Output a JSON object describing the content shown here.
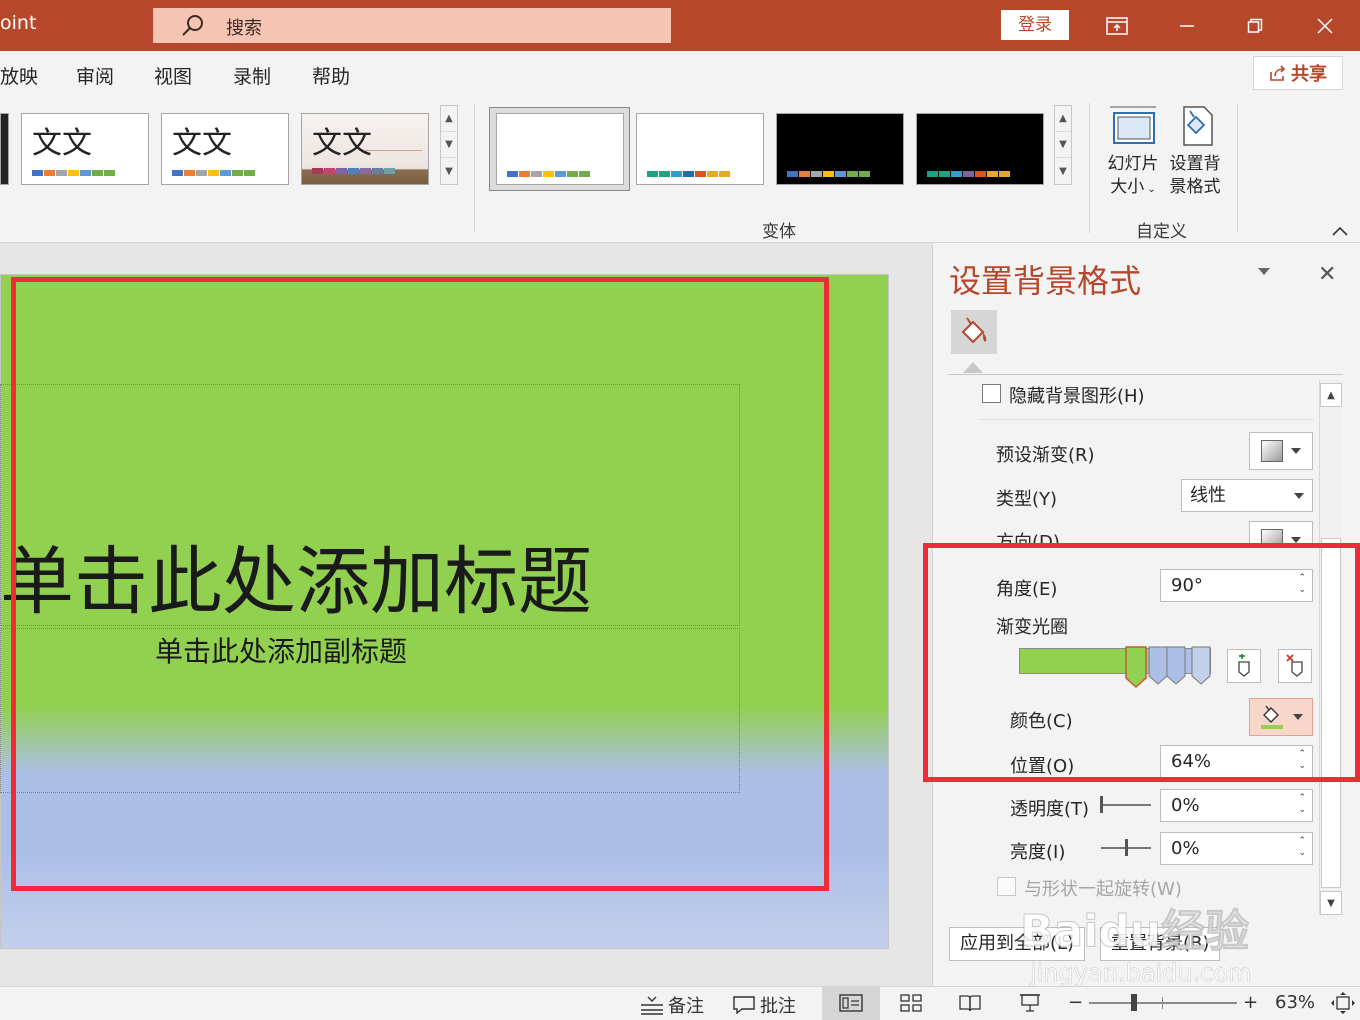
{
  "titlebar": {
    "app_title": "oint",
    "search_placeholder": "搜索",
    "login_label": "登录",
    "colors": {
      "background": "#b7472a",
      "search_bg": "#f6c4b3"
    }
  },
  "menu": {
    "tabs": [
      "放映",
      "审阅",
      "视图",
      "录制",
      "帮助"
    ],
    "share_label": "共享"
  },
  "ribbon": {
    "theme_thumb_text": "文文",
    "variants_group_label": "变体",
    "customize_group_label": "自定义",
    "slide_size_label_1": "幻灯片",
    "slide_size_label_2": "大小",
    "bg_format_label_1": "设置背",
    "bg_format_label_2": "景格式"
  },
  "slide": {
    "title_placeholder": "单击此处添加标题",
    "subtitle_placeholder": "单击此处添加副标题",
    "colors": {
      "top": "#92d050",
      "bottom": "#acbfe6"
    }
  },
  "pane": {
    "title": "设置背景格式",
    "hide_bg_graphics": "隐藏背景图形(H)",
    "preset_gradient": "预设渐变(R)",
    "type_label": "类型(Y)",
    "type_value": "线性",
    "direction_label": "方向(D)",
    "angle_label": "角度(E)",
    "angle_value": "90°",
    "gradient_stops_label": "渐变光圈",
    "color_label": "颜色(C)",
    "position_label": "位置(O)",
    "position_value": "64%",
    "transparency_label": "透明度(T)",
    "transparency_value": "0%",
    "brightness_label": "亮度(I)",
    "brightness_value": "0%",
    "rotate_with_shape": "与形状一起旋转(W)",
    "apply_all": "应用到全部(L)",
    "reset_bg": "重置背景(B)"
  },
  "statusbar": {
    "notes": "备注",
    "comments": "批注",
    "zoom_minus": "−",
    "zoom_plus": "+",
    "zoom_value": "63%"
  },
  "watermark": {
    "text": "Baidu经验",
    "url": "jingyan.baidu.com"
  }
}
